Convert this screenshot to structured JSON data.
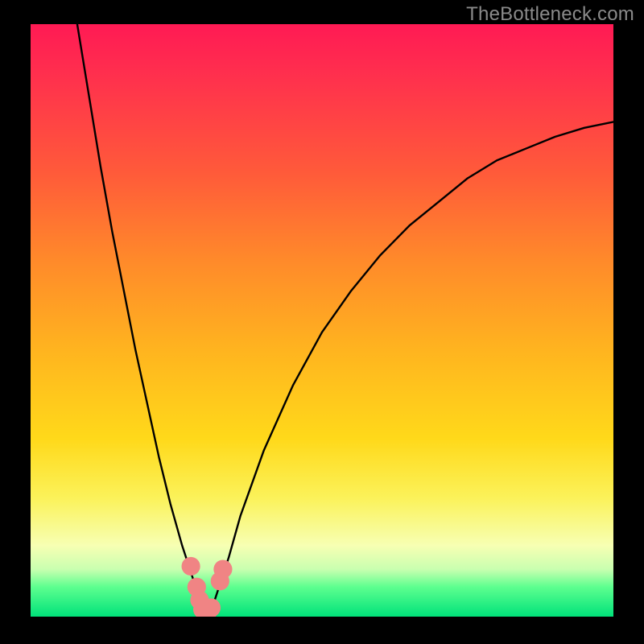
{
  "watermark": "TheBottleneck.com",
  "colors": {
    "curve_stroke": "#000000",
    "marker_fill": "#f08484",
    "bg_top": "#ff1a54",
    "bg_bottom": "#00e27a",
    "frame": "#000000"
  },
  "chart_data": {
    "type": "line",
    "title": "",
    "xlabel": "",
    "ylabel": "",
    "xlim": [
      0,
      100
    ],
    "ylim": [
      0,
      100
    ],
    "series": [
      {
        "name": "bottleneck-curve",
        "x": [
          8,
          10,
          12,
          14,
          16,
          18,
          20,
          22,
          24,
          26,
          28,
          29,
          30,
          31,
          32,
          34,
          36,
          40,
          45,
          50,
          55,
          60,
          65,
          70,
          75,
          80,
          85,
          90,
          95,
          100
        ],
        "values": [
          100,
          88,
          76,
          65,
          55,
          45,
          36,
          27,
          19,
          12,
          6,
          3,
          1,
          1,
          4,
          10,
          17,
          28,
          39,
          48,
          55,
          61,
          66,
          70,
          74,
          77,
          79,
          81,
          82.5,
          83.5
        ]
      }
    ],
    "markers": {
      "name": "highlight-markers",
      "points": [
        {
          "x": 27.5,
          "y": 8.5
        },
        {
          "x": 28.5,
          "y": 5.0
        },
        {
          "x": 29.0,
          "y": 2.8
        },
        {
          "x": 29.5,
          "y": 1.2
        },
        {
          "x": 30.5,
          "y": 1.0
        },
        {
          "x": 31.0,
          "y": 1.5
        },
        {
          "x": 32.5,
          "y": 6.0
        },
        {
          "x": 33.0,
          "y": 8.0
        }
      ],
      "radius_data_units": 1.6
    }
  }
}
